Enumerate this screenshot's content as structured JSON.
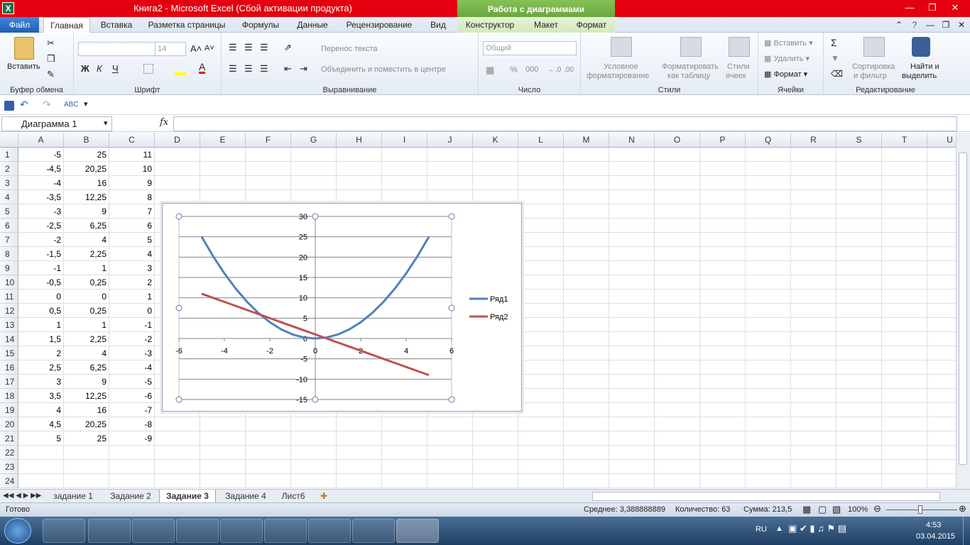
{
  "window": {
    "title": "Книга2  -  Microsoft Excel (Сбой активации продукта)",
    "context_group": "Работа с диаграммами"
  },
  "tabs": [
    "Файл",
    "Главная",
    "Вставка",
    "Разметка страницы",
    "Формулы",
    "Данные",
    "Рецензирование",
    "Вид"
  ],
  "context_tabs": [
    "Конструктор",
    "Макет",
    "Формат"
  ],
  "ribbon": {
    "clipboard": {
      "label": "Буфер обмена",
      "paste": "Вставить"
    },
    "font": {
      "label": "Шрифт",
      "size": "14",
      "bold": "Ж",
      "italic": "К",
      "underline": "Ч"
    },
    "alignment": {
      "label": "Выравнивание",
      "wrap": "Перенос текста",
      "merge": "Объединить и поместить в центре"
    },
    "number": {
      "label": "Число",
      "format": "Общий",
      "percent": "%",
      "thousands": "000"
    },
    "styles": {
      "label": "Стили",
      "conditional_1": "Условное",
      "conditional_2": "форматирование",
      "table_1": "Форматировать",
      "table_2": "как таблицу",
      "cell_1": "Стили",
      "cell_2": "ячеек"
    },
    "cells": {
      "label": "Ячейки",
      "insert": "Вставить",
      "delete": "Удалить",
      "format": "Формат"
    },
    "editing": {
      "label": "Редактирование",
      "sort_1": "Сортировка",
      "sort_2": "и фильтр",
      "find_1": "Найти и",
      "find_2": "выделить"
    }
  },
  "formula_bar": {
    "name_box": "Диаграмма 1",
    "fx": "fx",
    "formula": ""
  },
  "columns": [
    "A",
    "B",
    "C",
    "D",
    "E",
    "F",
    "G",
    "H",
    "I",
    "J",
    "K",
    "L",
    "M",
    "N",
    "O",
    "P",
    "Q",
    "R",
    "S",
    "T",
    "U"
  ],
  "rows": [
    [
      "-5",
      "25",
      "11"
    ],
    [
      "-4,5",
      "20,25",
      "10"
    ],
    [
      "-4",
      "16",
      "9"
    ],
    [
      "-3,5",
      "12,25",
      "8"
    ],
    [
      "-3",
      "9",
      "7"
    ],
    [
      "-2,5",
      "6,25",
      "6"
    ],
    [
      "-2",
      "4",
      "5"
    ],
    [
      "-1,5",
      "2,25",
      "4"
    ],
    [
      "-1",
      "1",
      "3"
    ],
    [
      "-0,5",
      "0,25",
      "2"
    ],
    [
      "0",
      "0",
      "1"
    ],
    [
      "0,5",
      "0,25",
      "0"
    ],
    [
      "1",
      "1",
      "-1"
    ],
    [
      "1,5",
      "2,25",
      "-2"
    ],
    [
      "2",
      "4",
      "-3"
    ],
    [
      "2,5",
      "6,25",
      "-4"
    ],
    [
      "3",
      "9",
      "-5"
    ],
    [
      "3,5",
      "12,25",
      "-6"
    ],
    [
      "4",
      "16",
      "-7"
    ],
    [
      "4,5",
      "20,25",
      "-8"
    ],
    [
      "5",
      "25",
      "-9"
    ],
    [
      "",
      "",
      ""
    ],
    [
      "",
      "",
      ""
    ],
    [
      "",
      "",
      ""
    ]
  ],
  "chart_data": {
    "type": "scatter",
    "title": "",
    "xlabel": "",
    "ylabel": "",
    "xlim": [
      -6,
      6
    ],
    "ylim": [
      -15,
      30
    ],
    "x_ticks": [
      "-6",
      "-4",
      "-2",
      "0",
      "2",
      "4",
      "6"
    ],
    "y_ticks": [
      "30",
      "25",
      "20",
      "15",
      "10",
      "5",
      "0",
      "-5",
      "-10",
      "-15"
    ],
    "grid": "horizontal",
    "legend": "right",
    "x": [
      -5,
      -4.5,
      -4,
      -3.5,
      -3,
      -2.5,
      -2,
      -1.5,
      -1,
      -0.5,
      0,
      0.5,
      1,
      1.5,
      2,
      2.5,
      3,
      3.5,
      4,
      4.5,
      5
    ],
    "series": [
      {
        "name": "Ряд1",
        "color": "#4f81bd",
        "values": [
          25,
          20.25,
          16,
          12.25,
          9,
          6.25,
          4,
          2.25,
          1,
          0.25,
          0,
          0.25,
          1,
          2.25,
          4,
          6.25,
          9,
          12.25,
          16,
          20.25,
          25
        ]
      },
      {
        "name": "Ряд2",
        "color": "#c0504d",
        "values": [
          11,
          10,
          9,
          8,
          7,
          6,
          5,
          4,
          3,
          2,
          1,
          0,
          -1,
          -2,
          -3,
          -4,
          -5,
          -6,
          -7,
          -8,
          -9
        ]
      }
    ]
  },
  "sheets": [
    "задание 1",
    "Задание 2",
    "Задание 3",
    "Задание 4",
    "Лист6"
  ],
  "status": {
    "ready": "Готово",
    "average": "Среднее: 3,388888889",
    "count": "Количество: 63",
    "sum": "Сумма: 213,5",
    "zoom": "100%"
  },
  "tray": {
    "lang": "RU",
    "time": "4:53",
    "date": "03.04.2015"
  }
}
